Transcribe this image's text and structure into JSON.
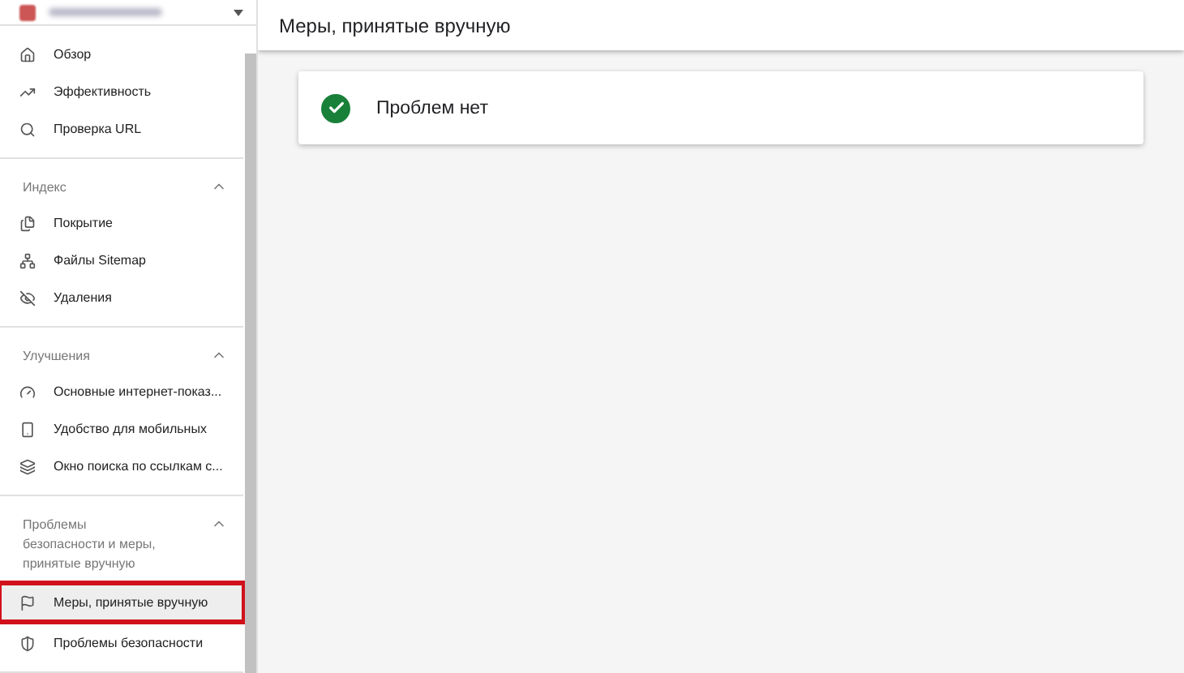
{
  "sidebar": {
    "top_items": [
      {
        "label": "Обзор",
        "selected": false
      },
      {
        "label": "Эффективность",
        "selected": false
      },
      {
        "label": "Проверка URL",
        "selected": false
      }
    ],
    "sections": [
      {
        "title": "Индекс",
        "expanded": true,
        "items": [
          {
            "label": "Покрытие",
            "selected": false
          },
          {
            "label": "Файлы Sitemap",
            "selected": false
          },
          {
            "label": "Удаления",
            "selected": false
          }
        ]
      },
      {
        "title": "Улучшения",
        "expanded": true,
        "items": [
          {
            "label": "Основные интернет-показ...",
            "selected": false
          },
          {
            "label": "Удобство для мобильных",
            "selected": false
          },
          {
            "label": "Окно поиска по ссылкам с...",
            "selected": false
          }
        ]
      },
      {
        "title": "Проблемы безопасности и меры, принятые вручную",
        "expanded": true,
        "items": [
          {
            "label": "Меры, принятые вручную",
            "selected": true
          },
          {
            "label": "Проблемы безопасности",
            "selected": false
          }
        ]
      }
    ]
  },
  "header": {
    "title": "Меры, принятые вручную"
  },
  "status_card": {
    "message": "Проблем нет"
  }
}
